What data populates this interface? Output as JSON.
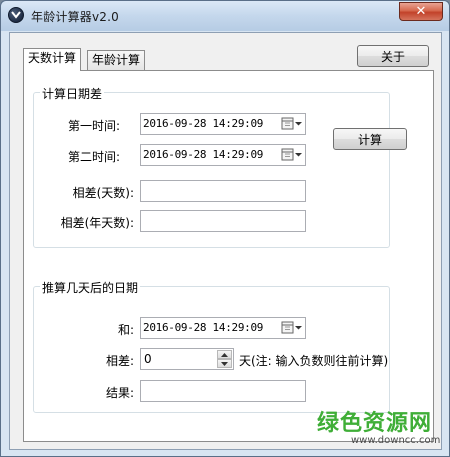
{
  "window": {
    "title": "年龄计算器v2.0",
    "close_label": "✕"
  },
  "tabs": [
    {
      "label": "天数计算",
      "active": true
    },
    {
      "label": "年龄计算",
      "active": false
    }
  ],
  "about_button": "关于",
  "group_diff": {
    "legend": "计算日期差",
    "first_label": "第一时间:",
    "first_value": "2016-09-28 14:29:09",
    "second_label": "第二时间:",
    "second_value": "2016-09-28 14:29:09",
    "calc_button": "计算",
    "days_label": "相差(天数):",
    "days_value": "",
    "years_label": "相差(年天数):",
    "years_value": ""
  },
  "group_infer": {
    "legend": "推算几天后的日期",
    "and_label": "和:",
    "and_value": "2016-09-28 14:29:09",
    "diff_label": "相差:",
    "diff_value": "0",
    "diff_note": "天(注: 输入负数则往前计算)",
    "result_label": "结果:",
    "result_value": ""
  },
  "watermark": {
    "main": "绿色资源网",
    "sub": "www.downcc.com"
  },
  "colors": {
    "watermark_green": "#3fae37",
    "close_red": "#c2422a"
  }
}
